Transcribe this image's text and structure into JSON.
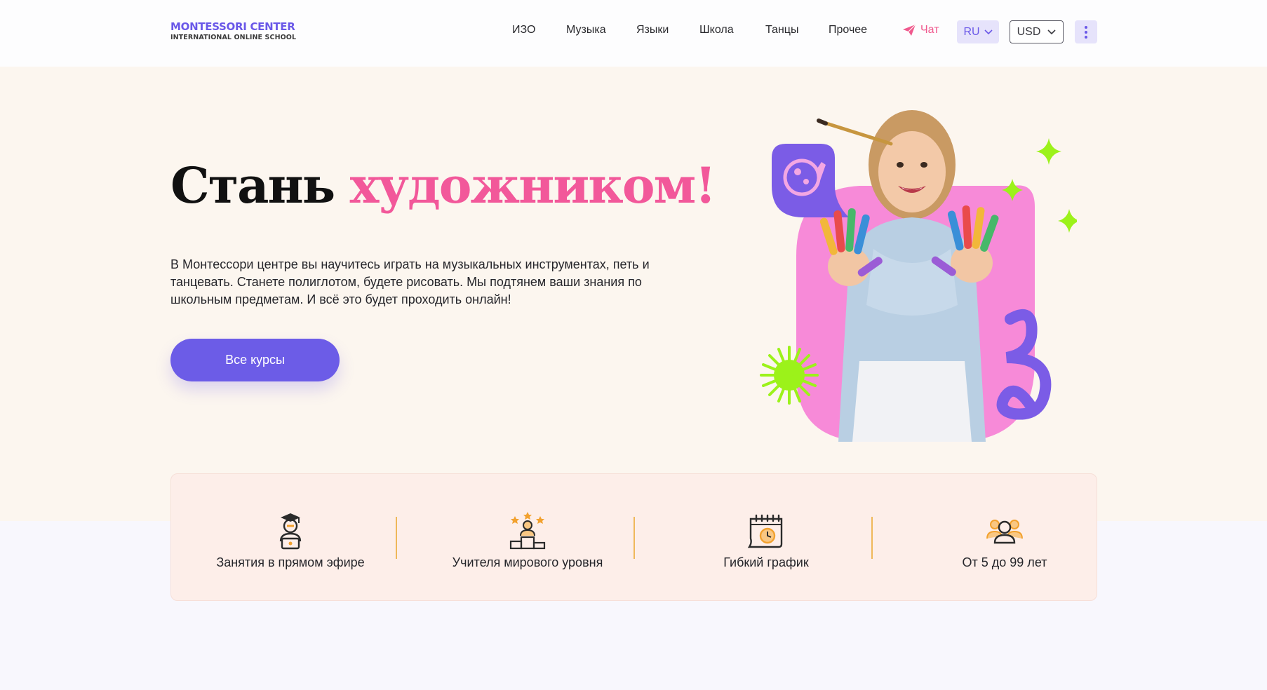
{
  "header": {
    "logo_top": "MONTESSORI CENTER",
    "logo_bottom": "INTERNATIONAL ONLINE SCHOOL",
    "nav": [
      "ИЗО",
      "Музыка",
      "Языки",
      "Школа",
      "Танцы",
      "Прочее"
    ],
    "chat_label": "Чат",
    "language": "RU",
    "currency": "USD"
  },
  "hero": {
    "title_part1": "Стань ",
    "title_part2": "художником!",
    "description": "В Монтессори центре вы научитесь играть на музыкальных инструментах, петь и танцевать. Станете полиглотом, будете рисовать. Мы подтянем ваши знания по школьным предметам. И всё это будет проходить онлайн!",
    "cta_label": "Все курсы"
  },
  "features": [
    {
      "label": "Занятия в прямом эфире",
      "icon": "graduate-laptop-icon"
    },
    {
      "label": "Учителя мирового уровня",
      "icon": "podium-stars-icon"
    },
    {
      "label": "Гибкий график",
      "icon": "calendar-clock-icon"
    },
    {
      "label": "От 5 до 99 лет",
      "icon": "people-group-icon"
    }
  ],
  "colors": {
    "brand": "#6c5ce7",
    "accent_pink": "#f2589a",
    "hero_bg": "#fcf6ef",
    "features_bg": "#fdeee9",
    "icon_orange": "#f2a12e",
    "lime": "#9cf21a"
  }
}
